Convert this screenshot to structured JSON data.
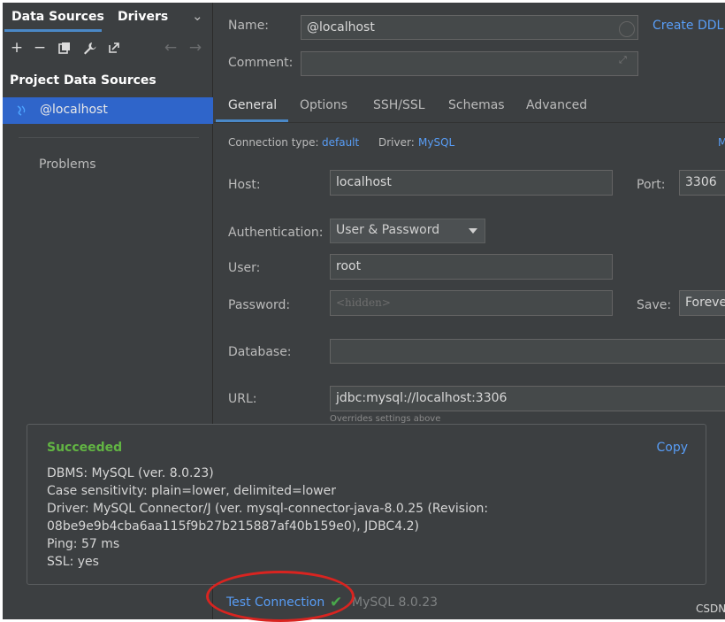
{
  "sidebar": {
    "tabs": [
      "Data Sources",
      "Drivers"
    ],
    "project_title": "Project Data Sources",
    "selected_source": "@localhost",
    "problems": "Problems"
  },
  "main": {
    "name_label": "Name:",
    "name_value": "@localhost",
    "create_ddl": "Create DDL M",
    "comment_label": "Comment:",
    "comment_value": "",
    "tabs": [
      "General",
      "Options",
      "SSH/SSL",
      "Schemas",
      "Advanced"
    ],
    "connection_type_label": "Connection type:",
    "connection_type_value": "default",
    "driver_label": "Driver:",
    "driver_value": "MySQL",
    "right_cut_link": "M",
    "host_label": "Host:",
    "host_value": "localhost",
    "port_label": "Port:",
    "port_value": "3306",
    "auth_label": "Authentication:",
    "auth_value": "User & Password",
    "user_label": "User:",
    "user_value": "root",
    "password_label": "Password:",
    "password_placeholder": "<hidden>",
    "save_label": "Save:",
    "save_value": "Foreve",
    "database_label": "Database:",
    "database_value": "",
    "url_label": "URL:",
    "url_value": "jdbc:mysql://localhost:3306",
    "url_hint": "Overrides settings above"
  },
  "popup": {
    "title": "Succeeded",
    "copy": "Copy",
    "lines": [
      "DBMS: MySQL (ver. 8.0.23)",
      "Case sensitivity: plain=lower, delimited=lower",
      "Driver: MySQL Connector/J (ver. mysql-connector-java-8.0.25 (Revision:",
      "08be9e9b4cba6aa115f9b27b215887af40b159e0), JDBC4.2)",
      "Ping: 57 ms",
      "SSL: yes"
    ]
  },
  "bottom": {
    "test_connection": "Test Connection",
    "mysql_version": "MySQL 8.0.23",
    "watermark": "CSDN"
  },
  "colors": {
    "background": "#3c3f41",
    "selection": "#2f65ca",
    "link": "#589df6",
    "success": "#62b543",
    "annotation_circle": "#d92420"
  },
  "icons": [
    "add-icon",
    "remove-icon",
    "duplicate-icon",
    "wrench-icon",
    "external-link-icon",
    "back-arrow-icon",
    "forward-arrow-icon",
    "chevron-down-icon",
    "datasource-icon",
    "check-icon"
  ]
}
